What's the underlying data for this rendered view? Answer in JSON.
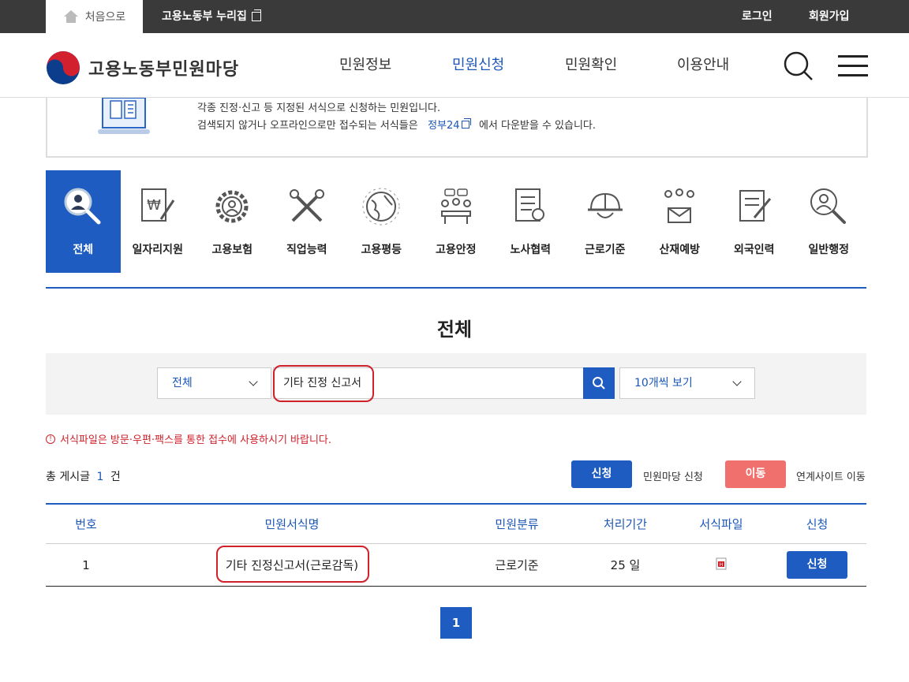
{
  "topbar": {
    "home_label": "처음으로",
    "nuri_label": "고용노동부 누리집",
    "login_label": "로그인",
    "join_label": "회원가입"
  },
  "header": {
    "logo_text": "고용노동부민원마당",
    "nav": [
      "민원정보",
      "민원신청",
      "민원확인",
      "이용안내"
    ],
    "active_nav": "민원신청"
  },
  "info": {
    "line1": "각종 진정·신고 등 지정된 서식으로 신청하는 민원입니다.",
    "line2_before": "검색되지 않거나 오프라인으로만 접수되는 서식들은",
    "gov24": "정부24",
    "line2_after": "에서 다운받을 수 있습니다."
  },
  "categories": [
    {
      "label": "전체",
      "icon": "magnifier-person-icon"
    },
    {
      "label": "일자리지원",
      "icon": "won-document-icon"
    },
    {
      "label": "고용보험",
      "icon": "gear-person-icon"
    },
    {
      "label": "직업능력",
      "icon": "tools-icon"
    },
    {
      "label": "고용평등",
      "icon": "globe-icon"
    },
    {
      "label": "고용안정",
      "icon": "meeting-icon"
    },
    {
      "label": "노사협력",
      "icon": "report-icon"
    },
    {
      "label": "근로기준",
      "icon": "helmet-icon"
    },
    {
      "label": "산재예방",
      "icon": "people-mail-icon"
    },
    {
      "label": "외국인력",
      "icon": "document-pen-icon"
    },
    {
      "label": "일반행정",
      "icon": "magnifier-person-icon"
    }
  ],
  "page_title": "전체",
  "search": {
    "category_select": "전체",
    "keyword": "기타 진정 신고서",
    "page_size_select": "10개씩 보기"
  },
  "notice": "서식파일은 방문·우편·팩스를 통한 접수에 사용하시기 바랍니다.",
  "total": {
    "prefix": "총 게시글",
    "count": "1",
    "suffix": "건"
  },
  "legend": {
    "apply_btn": "신청",
    "apply_text": "민원마당 신청",
    "move_btn": "이동",
    "move_text": "연계사이트 이동"
  },
  "table": {
    "headers": [
      "번호",
      "민원서식명",
      "민원분류",
      "처리기간",
      "서식파일",
      "신청"
    ],
    "rows": [
      {
        "no": "1",
        "name": "기타 진정신고서(근로감독)",
        "category": "근로기준",
        "period": "25 일",
        "file_icon": "hwp-file-icon",
        "action": "신청"
      }
    ]
  },
  "pagination": {
    "current": "1"
  },
  "colors": {
    "primary": "#1f5cc1",
    "topbar": "#3a3a3a",
    "danger": "#d0202a",
    "move_btn": "#f0706e"
  }
}
